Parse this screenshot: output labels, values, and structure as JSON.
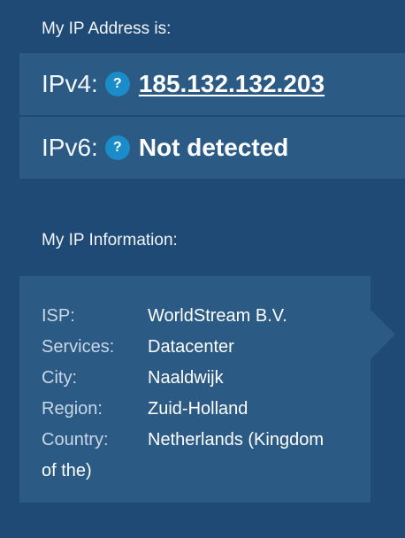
{
  "address_section": {
    "heading": "My IP Address is:",
    "ipv4": {
      "label": "IPv4:",
      "help": "?",
      "value": "185.132.132.203"
    },
    "ipv6": {
      "label": "IPv6:",
      "help": "?",
      "value": "Not detected"
    }
  },
  "info_section": {
    "heading": "My IP Information:",
    "rows": [
      {
        "key": "ISP:",
        "value": "WorldStream B.V."
      },
      {
        "key": "Services:",
        "value": "Datacenter"
      },
      {
        "key": "City:",
        "value": "Naaldwijk"
      },
      {
        "key": "Region:",
        "value": "Zuid-Holland"
      },
      {
        "key": "Country:",
        "value": "Netherlands (Kingdom",
        "value_cont": "of the)"
      }
    ]
  },
  "colors": {
    "background": "#1f4a75",
    "panel": "#2b5a85",
    "help_badge": "#1a8cc9"
  },
  "icons": {
    "help": "question-circle-icon",
    "panel_pointer": "arrow-right-icon"
  }
}
